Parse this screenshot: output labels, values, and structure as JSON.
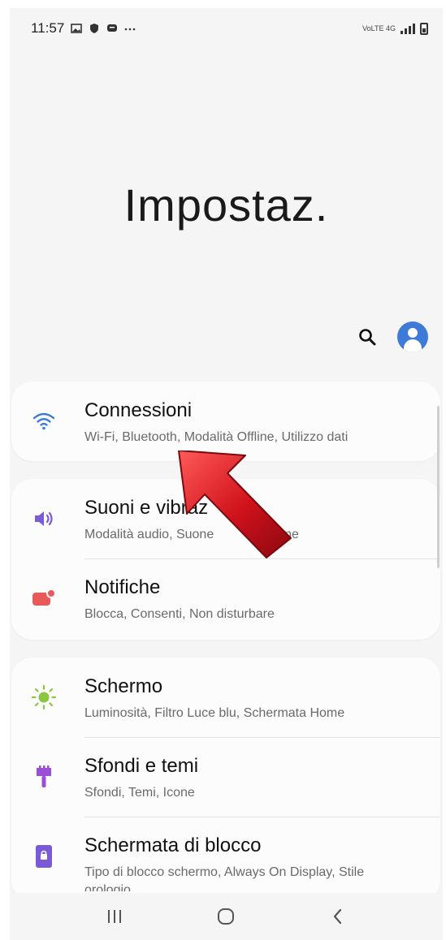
{
  "status_bar": {
    "time": "11:57",
    "left_icons": [
      "gallery-icon",
      "shield-icon",
      "chat-icon",
      "more-icon"
    ],
    "right_text": "VoLTE 4G"
  },
  "header": {
    "title": "Impostaz."
  },
  "actions": {
    "search_icon": "search-icon",
    "account_icon": "account-icon",
    "accent": "#3e7bd9"
  },
  "settings": {
    "connections": {
      "label": "Connessioni",
      "sub": "Wi-Fi, Bluetooth, Modalità Offline, Utilizzo dati",
      "icon": "wifi-icon",
      "color": "#3a7bd5"
    },
    "sounds": {
      "label": "Suoni e vibraz",
      "sub": "Modalità audio, Suone",
      "sub_tail": "lume",
      "icon": "speaker-icon",
      "color": "#7b5bd8"
    },
    "notifications": {
      "label": "Notifiche",
      "sub": "Blocca, Consenti, Non disturbare",
      "icon": "notification-icon",
      "color": "#e85a5a"
    },
    "display": {
      "label": "Schermo",
      "sub": "Luminosità, Filtro Luce blu, Schermata Home",
      "icon": "brightness-icon",
      "color": "#8cc63f"
    },
    "wallpapers": {
      "label": "Sfondi e temi",
      "sub": "Sfondi, Temi, Icone",
      "icon": "brush-icon",
      "color": "#9b4fd6"
    },
    "lockscreen": {
      "label": "Schermata di blocco",
      "sub": "Tipo di blocco schermo, Always On Display, Stile",
      "sub_cut": "orologio",
      "icon": "lock-screen-icon",
      "color": "#7a5ad6"
    }
  },
  "nav_bar": {
    "recents": "recents-icon",
    "home": "home-icon",
    "back": "back-icon"
  },
  "overlay": {
    "arrow": "red-pointer-arrow",
    "color": "#d0121b"
  }
}
